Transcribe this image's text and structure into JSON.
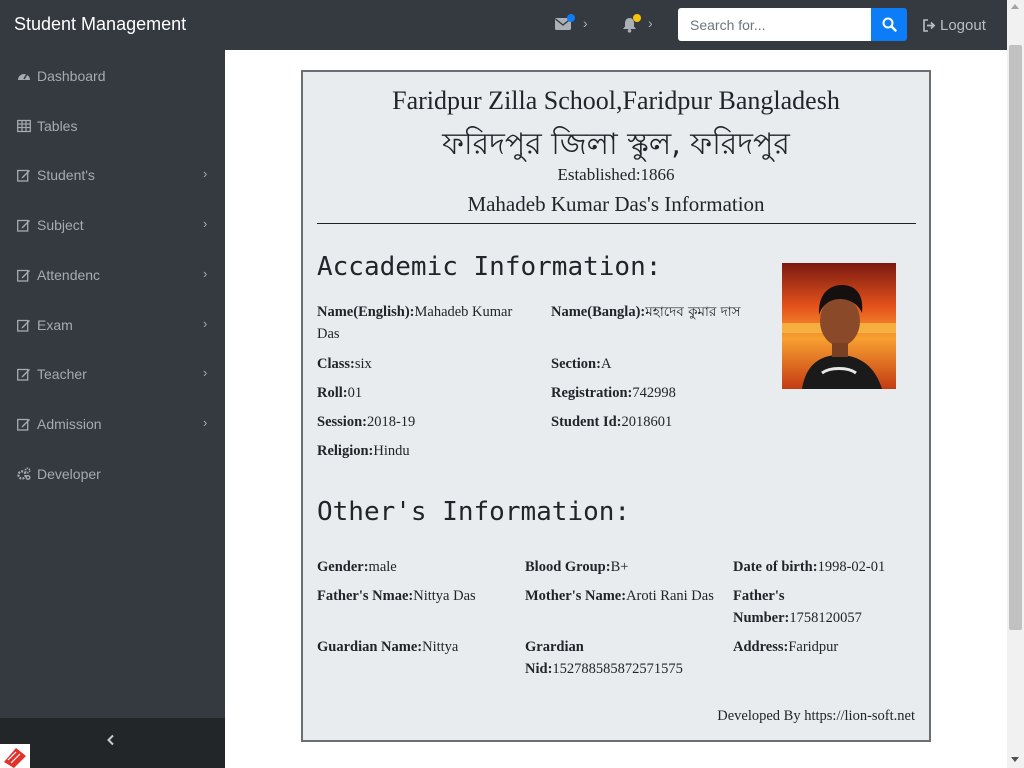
{
  "app": {
    "brand": "Student Management"
  },
  "topbar": {
    "search_placeholder": "Search for...",
    "logout_label": "Logout",
    "icons": [
      "envelope-icon",
      "bell-icon",
      "search-icon",
      "sign-out-icon"
    ],
    "colors": {
      "bar": "#343a40",
      "accent": "#0d7df7",
      "bell_badge": "#f7c40d"
    }
  },
  "sidebar": {
    "items": [
      {
        "label": "Dashboard",
        "icon": "tachometer-icon",
        "has_submenu": false
      },
      {
        "label": "Tables",
        "icon": "table-icon",
        "has_submenu": false
      },
      {
        "label": "Student's",
        "icon": "edit-icon",
        "has_submenu": true
      },
      {
        "label": "Subject",
        "icon": "edit-icon",
        "has_submenu": true
      },
      {
        "label": "Attendenc",
        "icon": "edit-icon",
        "has_submenu": true
      },
      {
        "label": "Exam",
        "icon": "edit-icon",
        "has_submenu": true
      },
      {
        "label": "Teacher",
        "icon": "edit-icon",
        "has_submenu": true
      },
      {
        "label": "Admission",
        "icon": "edit-icon",
        "has_submenu": true
      },
      {
        "label": "Developer",
        "icon": "cogs-icon",
        "has_submenu": false
      }
    ]
  },
  "card": {
    "school_en": "Faridpur Zilla School,Faridpur Bangladesh",
    "school_bn": "ফরিদপুর জিলা স্কুল, ফরিদপুর",
    "established": "Established:1866",
    "info_title": "Mahadeb Kumar Das's Information",
    "academic": {
      "heading": "Accademic Information:",
      "fields": [
        {
          "label": "Name(English):",
          "value": "Mahadeb Kumar Das"
        },
        {
          "label": "Name(Bangla):",
          "value": "মহাদেব কুমার দাস"
        },
        {
          "label": "Class:",
          "value": "six"
        },
        {
          "label": "Section:",
          "value": "A"
        },
        {
          "label": "Roll:",
          "value": "01"
        },
        {
          "label": "Registration:",
          "value": "742998"
        },
        {
          "label": "Session:",
          "value": "2018-19"
        },
        {
          "label": "Student Id:",
          "value": "2018601"
        },
        {
          "label": "Religion:",
          "value": "Hindu"
        }
      ]
    },
    "other": {
      "heading": "Other's Information:",
      "fields": [
        {
          "label": "Gender:",
          "value": "male"
        },
        {
          "label": "Blood Group:",
          "value": "B+"
        },
        {
          "label": "Date of birth:",
          "value": "1998-02-01"
        },
        {
          "label": "Father's Nmae:",
          "value": "Nittya Das"
        },
        {
          "label": "Mother's Name:",
          "value": "Aroti Rani Das"
        },
        {
          "label": "Father's Number:",
          "value": "1758120057"
        },
        {
          "label": "Guardian Name:",
          "value": "Nittya"
        },
        {
          "label": "Grardian Nid:",
          "value": "152788585872571575"
        },
        {
          "label": "Address:",
          "value": "Faridpur"
        }
      ]
    },
    "credit": "Developed By https://lion-soft.net"
  }
}
